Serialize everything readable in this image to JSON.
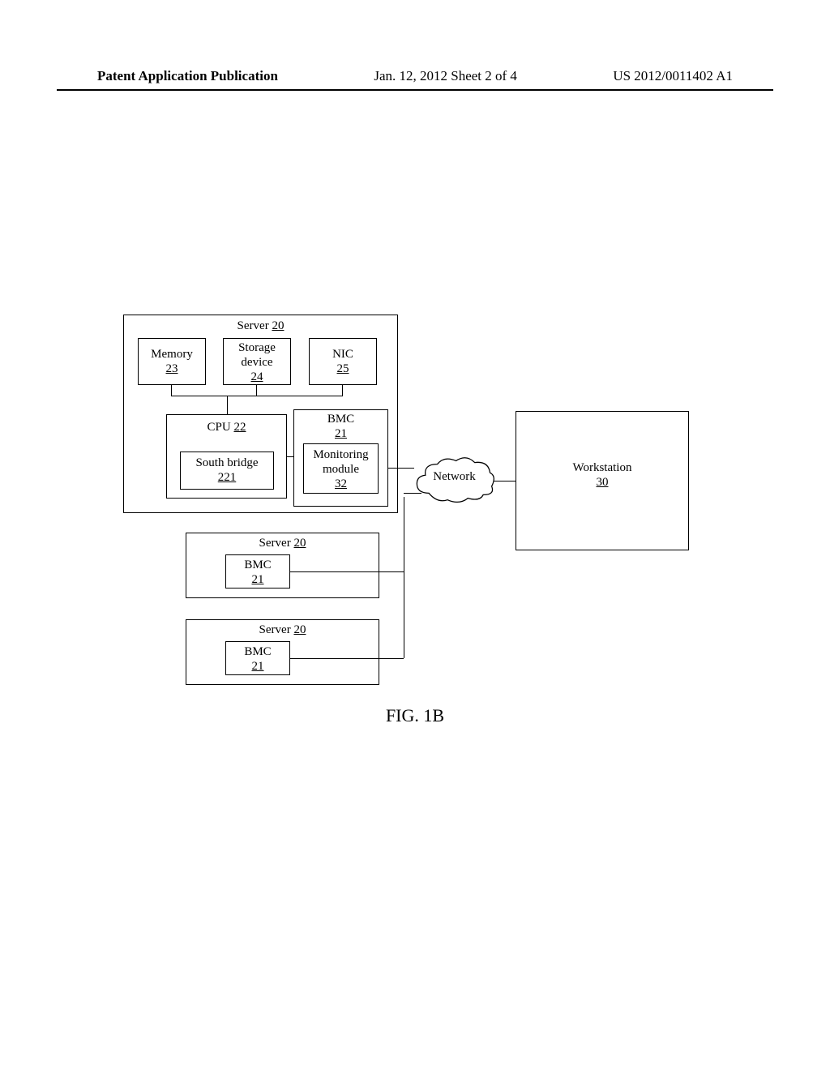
{
  "header": {
    "left": "Patent Application Publication",
    "center": "Jan. 12, 2012  Sheet 2 of 4",
    "right": "US 2012/0011402 A1"
  },
  "server1": {
    "title": "Server",
    "title_ref": "20"
  },
  "memory": {
    "label": "Memory",
    "ref": "23"
  },
  "storage": {
    "label_1": "Storage",
    "label_2": "device",
    "ref": "24"
  },
  "nic": {
    "label": "NIC",
    "ref": "25"
  },
  "cpu": {
    "label": "CPU",
    "ref": "22"
  },
  "south_bridge": {
    "label": "South bridge",
    "ref": "221"
  },
  "bmc1": {
    "label": "BMC",
    "ref": "21"
  },
  "monitoring": {
    "label_1": "Monitoring",
    "label_2": "module",
    "ref": "32"
  },
  "server2": {
    "title": "Server",
    "title_ref": "20"
  },
  "bmc2": {
    "label": "BMC",
    "ref": "21"
  },
  "server3": {
    "title": "Server",
    "title_ref": "20"
  },
  "bmc3": {
    "label": "BMC",
    "ref": "21"
  },
  "network": {
    "label": "Network"
  },
  "workstation": {
    "label": "Workstation",
    "ref": "30"
  },
  "figure_caption": "FIG. 1B"
}
